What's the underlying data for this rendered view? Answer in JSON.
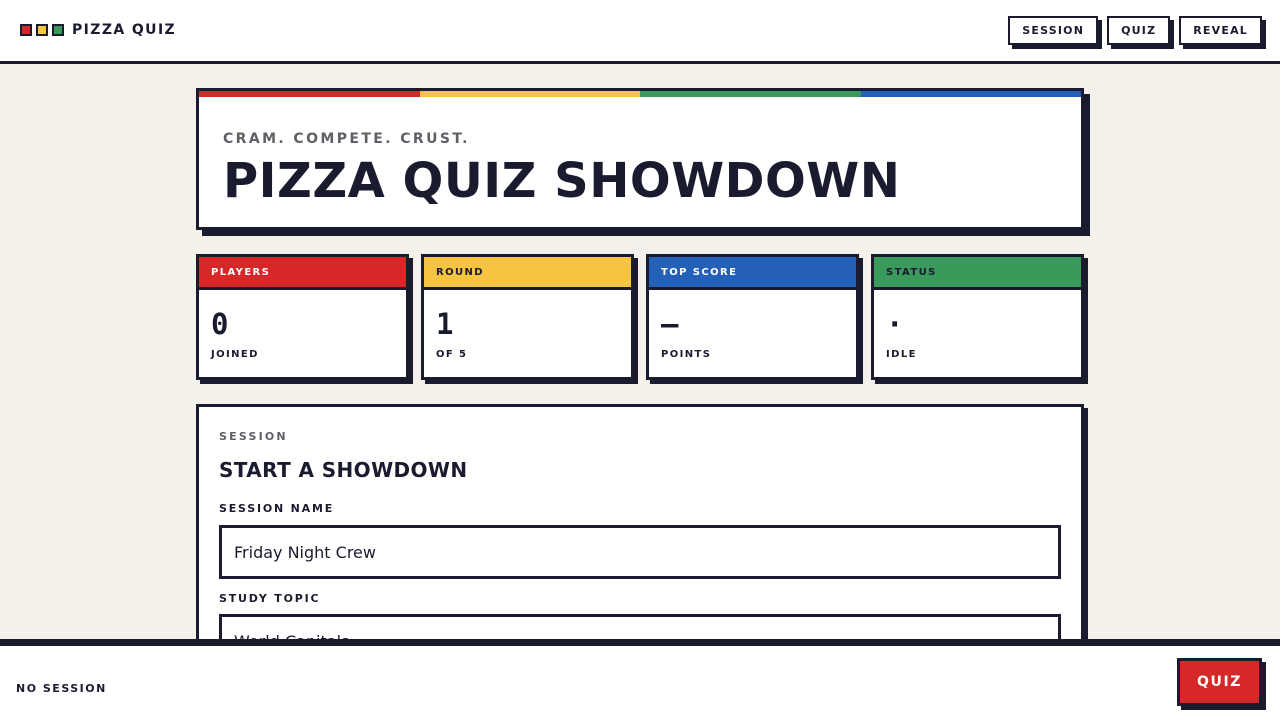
{
  "app": {
    "title": "PIZZA QUIZ",
    "logo_colors": [
      "#d62828",
      "#f5c542",
      "#3a9a5b"
    ]
  },
  "nav": [
    {
      "label": "SESSION"
    },
    {
      "label": "QUIZ"
    },
    {
      "label": "REVEAL"
    }
  ],
  "hero": {
    "kicker": "CRAM. COMPETE. CRUST.",
    "title": "PIZZA QUIZ SHOWDOWN",
    "stripe_colors": [
      "#d62828",
      "#f5c542",
      "#3a9a5b",
      "#2560b8"
    ]
  },
  "stats": [
    {
      "label": "PLAYERS",
      "value": "0",
      "sub": "JOINED",
      "color": "#d62828",
      "text_color": "#ffffff"
    },
    {
      "label": "ROUND",
      "value": "1",
      "sub": "OF 5",
      "color": "#f5c542",
      "text_color": "#1b1b2f"
    },
    {
      "label": "TOP SCORE",
      "value": "—",
      "sub": "POINTS",
      "color": "#2560b8",
      "text_color": "#ffffff"
    },
    {
      "label": "STATUS",
      "value": "·",
      "sub": "IDLE",
      "color": "#3a9a5b",
      "text_color": "#1b1b2f"
    }
  ],
  "session": {
    "kicker": "SESSION",
    "title": "START A SHOWDOWN",
    "fields": [
      {
        "label": "SESSION NAME",
        "value": "Friday Night Crew"
      },
      {
        "label": "STUDY TOPIC",
        "value": "World Capitals"
      }
    ]
  },
  "footer": {
    "status": "NO SESSION",
    "cta_label": "QUIZ",
    "cta_color": "#d62828"
  }
}
